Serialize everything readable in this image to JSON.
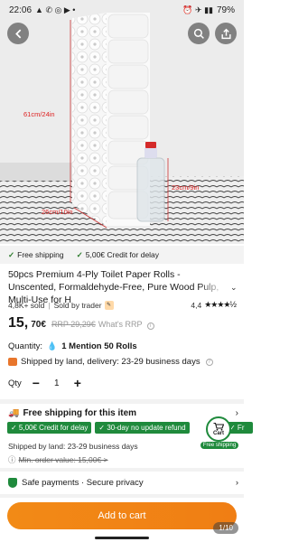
{
  "status_bar": {
    "time": "22:06",
    "battery": "79%"
  },
  "gallery": {
    "dimension_labels": [
      "61cm/24in",
      "23cm/9in",
      "26cm/10in"
    ],
    "counter": "1/10"
  },
  "shipping_strip": {
    "free_shipping": "Free shipping",
    "credit": "5,00€ Credit for delay"
  },
  "product": {
    "title": "50pcs Premium 4-Ply Toilet Paper Rolls - Unscented, Formaldehyde-Free, Pure Wood Pulp, Multi-Use for H",
    "sold": "4,8K+ sold",
    "seller": "Sold by trader",
    "rating": "4,4",
    "stars": "★★★★½",
    "price_main": "15,",
    "price_cents": "70€",
    "rrp": "RRP 29,29€",
    "what_rrp": "What's RRP",
    "quantity_label": "Quantity:",
    "quantity_value": "1 Mention 50 Rolls",
    "delivery": "Shipped by land, delivery: 23-29 business days",
    "qty_label": "Qty",
    "qty_value": "1"
  },
  "shipping": {
    "title": "Free shipping for this item",
    "tags": [
      "✓ 5,00€ Credit for delay",
      "✓ 30-day no update refund"
    ],
    "tag3": "✓ Fr",
    "cart_label": "Cart",
    "cart_badge": "Free shipping",
    "land": "Shipped by land: 23-29 business days",
    "min_order": "Min. order value: 15,00€ >"
  },
  "safety": {
    "title": "Safe payments · Secure privacy"
  },
  "cta": {
    "add_to_cart": "Add to cart"
  },
  "colors": {
    "accent": "#f28a16",
    "green": "#1f8a3c"
  }
}
